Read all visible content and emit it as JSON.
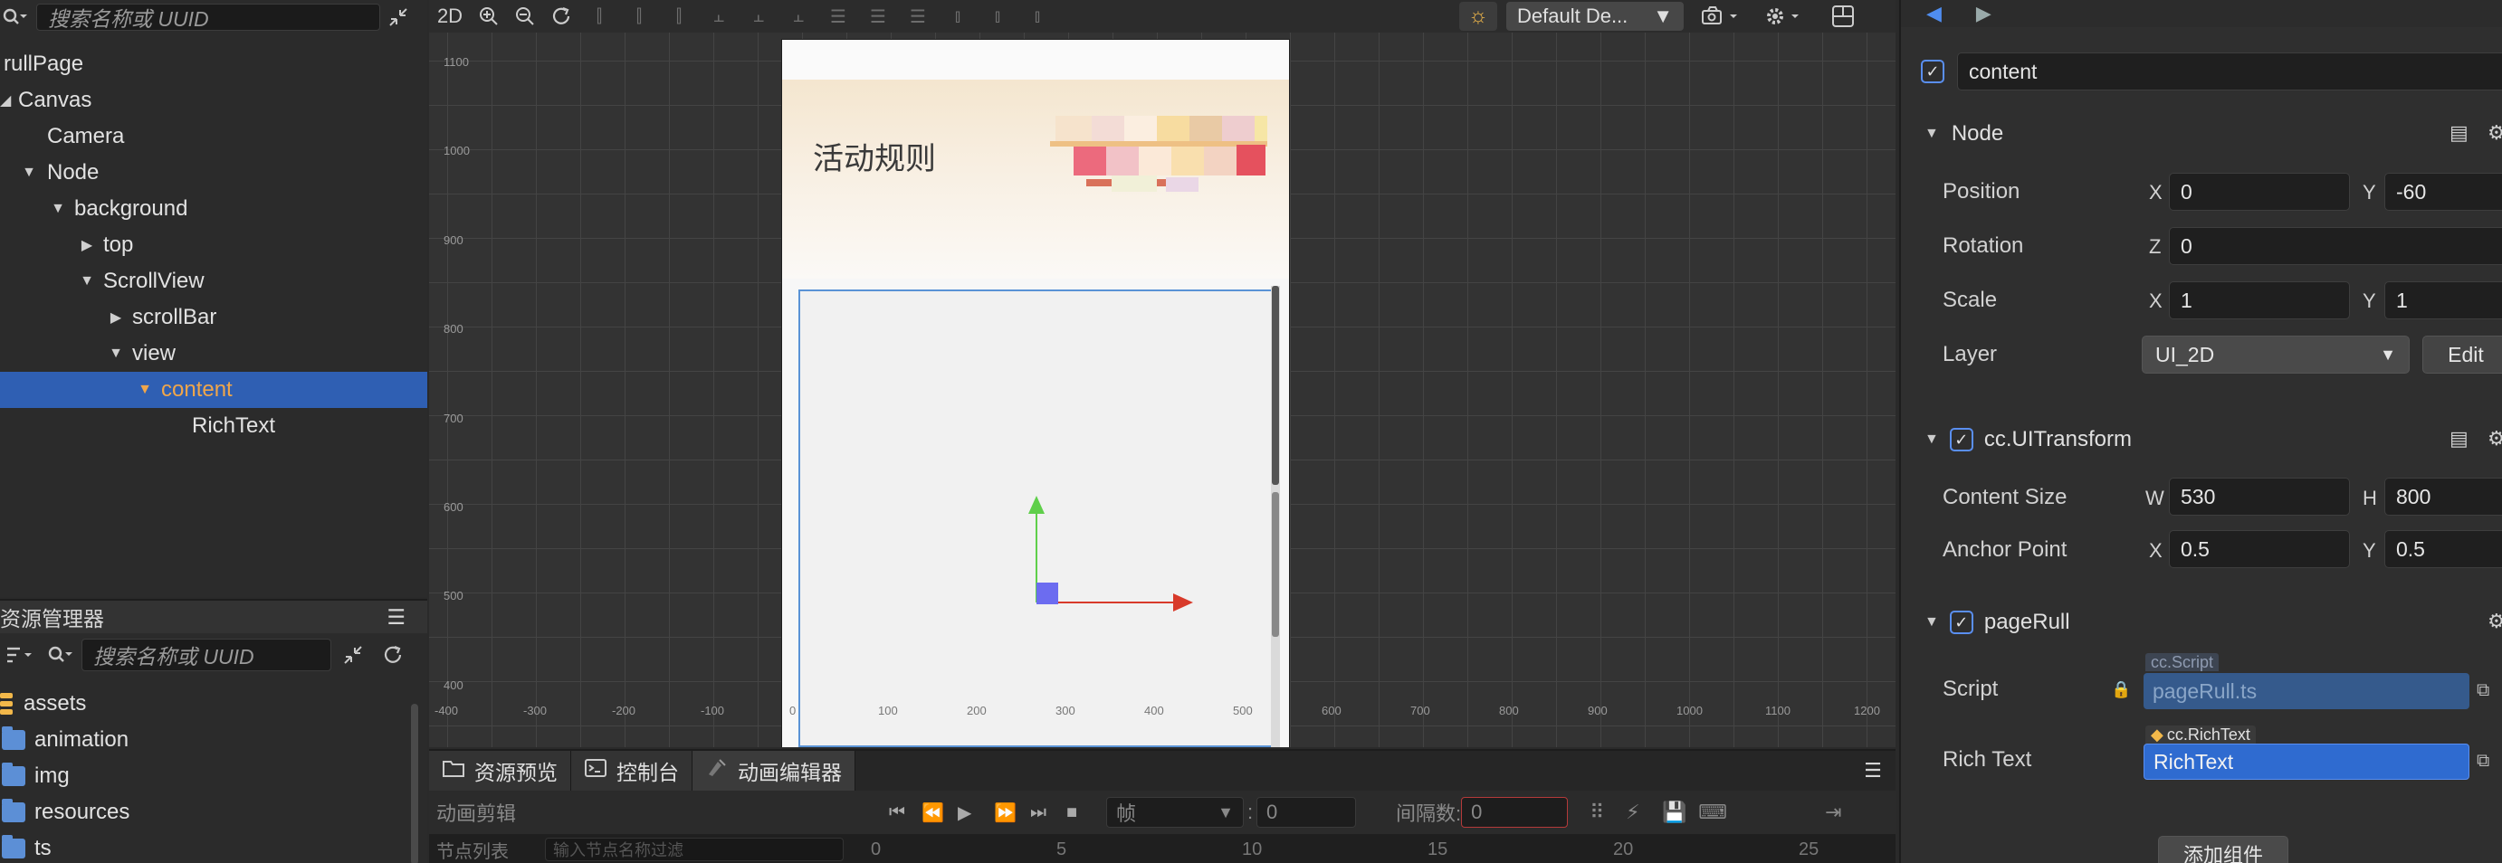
{
  "hierarchy": {
    "search_placeholder": "搜索名称或 UUID",
    "nodes": [
      {
        "label": "rullPage"
      },
      {
        "label": "Canvas"
      },
      {
        "label": "Camera"
      },
      {
        "label": "Node"
      },
      {
        "label": "background"
      },
      {
        "label": "top"
      },
      {
        "label": "ScrollView"
      },
      {
        "label": "scrollBar"
      },
      {
        "label": "view"
      },
      {
        "label": "content",
        "selected": true
      },
      {
        "label": "RichText"
      }
    ]
  },
  "assets": {
    "title": "资源管理器",
    "menu_icon": "☰",
    "search_placeholder": "搜索名称或 UUID",
    "items": [
      {
        "label": "assets",
        "icon": "database-icon"
      },
      {
        "label": "animation",
        "icon": "folder-icon"
      },
      {
        "label": "img",
        "icon": "folder-icon"
      },
      {
        "label": "resources",
        "icon": "folder-icon"
      },
      {
        "label": "ts",
        "icon": "folder-icon"
      }
    ]
  },
  "scene": {
    "mode_label": "2D",
    "device_label": "Default De...",
    "x_ticks": [
      "-400",
      "-300",
      "-200",
      "-100",
      "0",
      "100",
      "200",
      "300",
      "400",
      "500",
      "600",
      "700",
      "800",
      "900",
      "1000",
      "1100",
      "1200"
    ],
    "y_ticks": [
      "1100",
      "1000",
      "900",
      "800",
      "700",
      "600",
      "500",
      "400"
    ],
    "page_title": "活动规则"
  },
  "bottom": {
    "tabs": [
      {
        "label": "资源预览"
      },
      {
        "label": "控制台"
      },
      {
        "label": "动画编辑器"
      }
    ],
    "anim_clip_label": "动画剪辑",
    "frame_label": "帧",
    "frame_value": "0",
    "interval_label": "间隔数:",
    "interval_value": "0",
    "node_list_label": "节点列表",
    "node_filter_placeholder": "输入节点名称过滤",
    "timeline_ticks": [
      "0",
      "5",
      "10",
      "15",
      "20",
      "25"
    ]
  },
  "inspector": {
    "node_name": "content",
    "node_section": "Node",
    "position_label": "Position",
    "position_x": "0",
    "position_y": "-60",
    "rotation_label": "Rotation",
    "rotation_z": "0",
    "scale_label": "Scale",
    "scale_x": "1",
    "scale_y": "1",
    "layer_label": "Layer",
    "layer_value": "UI_2D",
    "edit_label": "Edit",
    "uitransform_section": "cc.UITransform",
    "content_size_label": "Content Size",
    "width": "530",
    "height": "800",
    "anchor_label": "Anchor Point",
    "anchor_x": "0.5",
    "anchor_y": "0.5",
    "script_section": "pageRull",
    "script_label": "Script",
    "script_type": "cc.Script",
    "script_value": "pageRull.ts",
    "richtext_label": "Rich Text",
    "richtext_type": "cc.RichText",
    "richtext_value": "RichText",
    "add_component_label": "添加组件",
    "axis_x": "X",
    "axis_y": "Y",
    "axis_z": "Z",
    "axis_w": "W",
    "axis_h": "H"
  }
}
